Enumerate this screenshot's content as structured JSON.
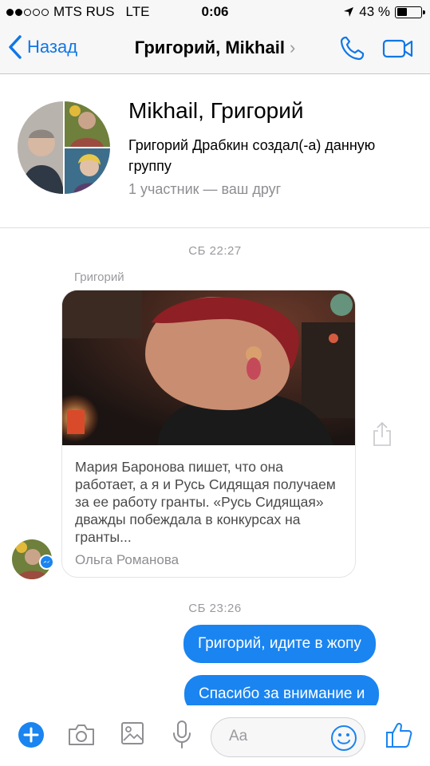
{
  "status_bar": {
    "carrier": "MTS RUS",
    "network": "LTE",
    "time": "0:06",
    "battery_percent": "43 %",
    "signal_bars_filled": 2,
    "signal_bars_total": 5,
    "battery_level": 0.43
  },
  "nav": {
    "back_label": "Назад",
    "title": "Григорий, Mikhail",
    "title_chevron": "›"
  },
  "group": {
    "name": "Mikhail, Григорий",
    "created_text": "Григорий Драбкин создал(-а) данную группу",
    "members_text": "1 участник — ваш друг"
  },
  "messages": {
    "timestamp_1": "СБ 22:27",
    "sender_name": "Григорий",
    "shared_post": {
      "text": "Мария Баронова пишет, что она работает, а я и Русь Сидящая получаем за ее работу гранты. «Русь Сидящая» дважды побеждала в конкурсах на гранты...",
      "author": "Ольга Романова"
    },
    "timestamp_2": "СБ 23:26",
    "outgoing": [
      "Григорий, идите в жопу",
      "Спасибо за внимание и"
    ]
  },
  "composer": {
    "placeholder": "Aa"
  },
  "colors": {
    "accent": "#1a84f0",
    "nav_link": "#0f77e6",
    "bar_background": "#f7f7f7",
    "muted_text": "#9a9a9f"
  },
  "icons": {
    "nav": [
      "chevron-left-icon",
      "phone-icon",
      "video-camera-icon"
    ],
    "composer": [
      "plus-icon",
      "camera-icon",
      "image-icon",
      "microphone-icon",
      "emoji-icon",
      "thumbs-up-icon"
    ],
    "message": [
      "share-icon",
      "messenger-badge-icon"
    ],
    "status": [
      "location-arrow-icon",
      "battery-icon"
    ]
  }
}
